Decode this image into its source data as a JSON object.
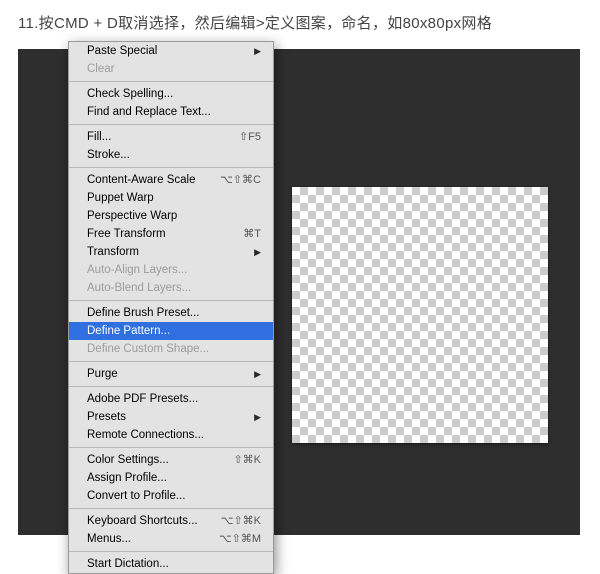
{
  "instruction": "11.按CMD + D取消选择，然后编辑>定义图案，命名，如80x80px网格",
  "menu": {
    "groups": [
      [
        {
          "label": "Paste Special",
          "submenu": true,
          "disabled": false
        },
        {
          "label": "Clear",
          "submenu": false,
          "disabled": true
        }
      ],
      [
        {
          "label": "Check Spelling...",
          "submenu": false,
          "disabled": false
        },
        {
          "label": "Find and Replace Text...",
          "submenu": false,
          "disabled": false
        }
      ],
      [
        {
          "label": "Fill...",
          "shortcut": "⇧F5",
          "disabled": false
        },
        {
          "label": "Stroke...",
          "disabled": false
        }
      ],
      [
        {
          "label": "Content-Aware Scale",
          "shortcut": "⌥⇧⌘C",
          "disabled": false
        },
        {
          "label": "Puppet Warp",
          "disabled": false
        },
        {
          "label": "Perspective Warp",
          "disabled": false
        },
        {
          "label": "Free Transform",
          "shortcut": "⌘T",
          "disabled": false
        },
        {
          "label": "Transform",
          "submenu": true,
          "disabled": false
        },
        {
          "label": "Auto-Align Layers...",
          "disabled": true
        },
        {
          "label": "Auto-Blend Layers...",
          "disabled": true
        }
      ],
      [
        {
          "label": "Define Brush Preset...",
          "disabled": false
        },
        {
          "label": "Define Pattern...",
          "disabled": false,
          "highlight": true
        },
        {
          "label": "Define Custom Shape...",
          "disabled": true
        }
      ],
      [
        {
          "label": "Purge",
          "submenu": true,
          "disabled": false
        }
      ],
      [
        {
          "label": "Adobe PDF Presets...",
          "disabled": false
        },
        {
          "label": "Presets",
          "submenu": true,
          "disabled": false
        },
        {
          "label": "Remote Connections...",
          "disabled": false
        }
      ],
      [
        {
          "label": "Color Settings...",
          "shortcut": "⇧⌘K",
          "disabled": false
        },
        {
          "label": "Assign Profile...",
          "disabled": false
        },
        {
          "label": "Convert to Profile...",
          "disabled": false
        }
      ],
      [
        {
          "label": "Keyboard Shortcuts...",
          "shortcut": "⌥⇧⌘K",
          "disabled": false
        },
        {
          "label": "Menus...",
          "shortcut": "⌥⇧⌘M",
          "disabled": false
        }
      ],
      [
        {
          "label": "Start Dictation...",
          "disabled": false
        }
      ]
    ]
  }
}
